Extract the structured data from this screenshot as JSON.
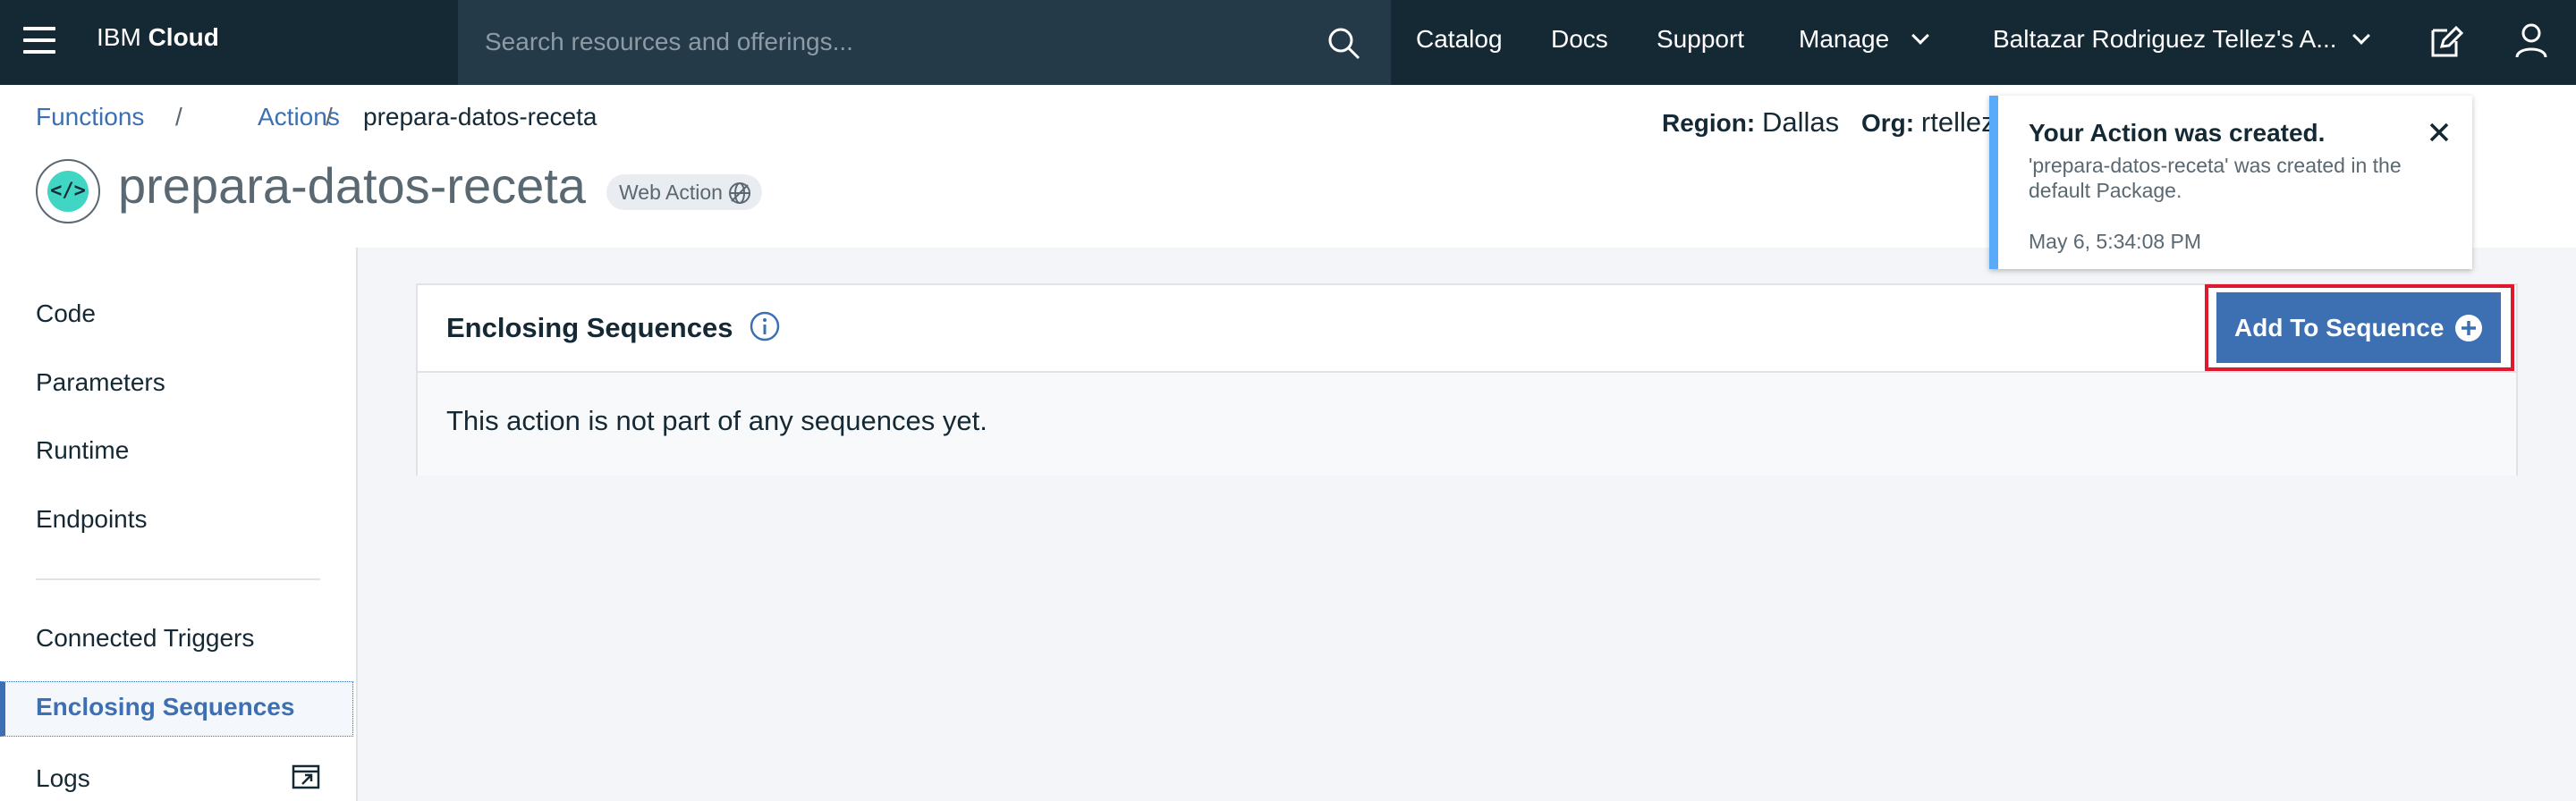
{
  "topnav": {
    "brand_prefix": "IBM",
    "brand_name": "Cloud",
    "search_placeholder": "Search resources and offerings...",
    "links": {
      "catalog": "Catalog",
      "docs": "Docs",
      "support": "Support",
      "manage": "Manage",
      "account": "Baltazar Rodriguez Tellez's A..."
    },
    "icons": [
      "menu-icon",
      "search-icon",
      "chevron-down-icon",
      "edit-icon",
      "user-icon"
    ]
  },
  "breadcrumb": {
    "functions": "Functions",
    "actions": "Actions",
    "separator": "/",
    "current": "prepara-datos-receta"
  },
  "action": {
    "name": "prepara-datos-receta",
    "badge": "Web Action",
    "region_label": "Region:",
    "region_value": "Dallas",
    "org_label": "Org:",
    "org_value": "rtellez"
  },
  "sidebar": {
    "items": [
      "Code",
      "Parameters",
      "Runtime",
      "Endpoints",
      "Connected Triggers",
      "Enclosing Sequences",
      "Logs"
    ],
    "active": "Enclosing Sequences"
  },
  "main": {
    "title": "Enclosing Sequences",
    "message": "This action is not part of any sequences yet.",
    "add_button": "Add To Sequence"
  },
  "toast": {
    "title": "Your Action was created.",
    "message": "'prepara-datos-receta' was created in the default Package.",
    "time": "May 6, 5:34:08 PM"
  },
  "colors": {
    "nav_bg": "#152935",
    "search_bg": "#253a48",
    "accent": "#3d70b2",
    "toast_border": "#5aaafa",
    "highlight": "#e0182d",
    "logo_teal": "#41d6c3"
  }
}
